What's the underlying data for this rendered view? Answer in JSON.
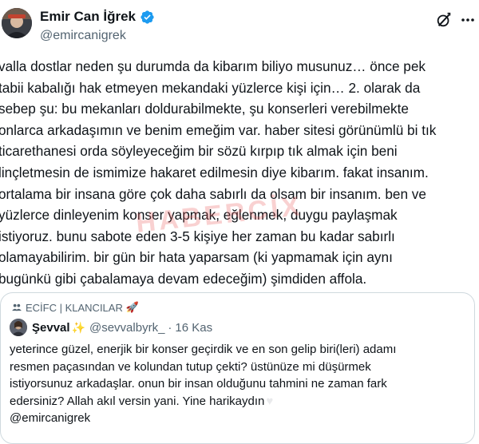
{
  "author": {
    "display_name": "Emir Can İğrek",
    "handle": "@emircanigrek"
  },
  "tweet": {
    "lines": [
      "valla dostlar neden şu durumda da kibarım biliyo musunuz… önce pek",
      "tabii kabalığı hak etmeyen mekandaki yüzlerce kişi için… 2. olarak da",
      "sebep şu: bu mekanları doldurabilmekte, şu konserleri verebilmekte",
      "onlarca arkadaşımın ve benim emeğim var. haber sitesi görünümlü bi tık",
      "ticarethanesi orda söyleyeceğim bir sözü kırpıp tık almak için beni",
      "linçletmesin de ismimize hakaret edilmesin diye kibarım. fakat insanım.",
      "ortalama bir insana göre çok daha sabırlı da olsam bir insanım. ben ve",
      "yüzlerce dinleyenim konser yapmak, eğlenmek, duygu paylaşmak",
      "istiyoruz. bunu sabote eden 3-5 kişiye her zaman bu kadar sabırlı",
      "olamayabilirim. bir gün bir hata yaparsam (ki yapmamak için aynı",
      "bugünkü gibi çabalamaya devam edeceğim) şimdiden affola."
    ]
  },
  "watermark": "HABERCİX",
  "quote": {
    "community": "ECİFC | KLANCILAR",
    "author_name": "Şevval",
    "author_handle": "@sevvalbyrk_",
    "separator": "·",
    "time": "16 Kas",
    "lines": [
      "yeterince güzel, enerjik bir konser geçirdik ve en son gelip biri(leri) adamı",
      "resmen paçasından ve kolundan tutup çekti? üstünüze mi düşürmek",
      "istiyorsunuz arkadaşlar. onun bir insan olduğunu tahmini ne zaman fark",
      "edersiniz? Allah akıl versin yani. Yine harikaydın",
      "@emircanigrek"
    ]
  },
  "icons": {
    "verified": "verified-badge-icon",
    "grok": "grok-icon",
    "more": "more-icon",
    "community": "community-icon",
    "rocket": "rocket-icon",
    "sparkle": "sparkle-icon",
    "heart": "white-heart-icon"
  },
  "colors": {
    "verified_blue": "#1d9bf0",
    "secondary_text": "#536471",
    "border": "#cfd9de"
  }
}
